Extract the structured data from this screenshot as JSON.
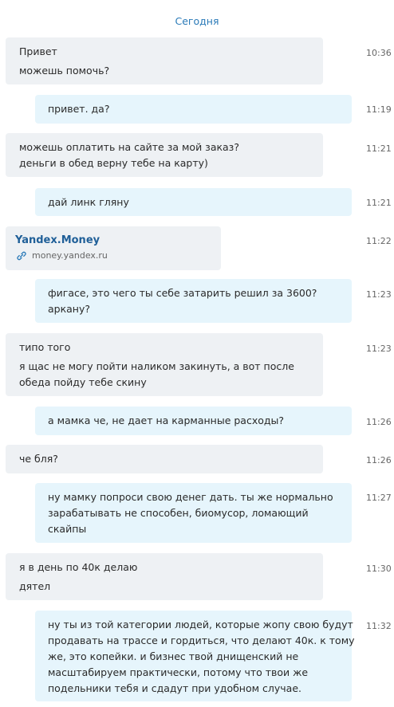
{
  "date_separator": "Сегодня",
  "messages": [
    {
      "dir": "in",
      "lines": [
        "Привет",
        "можешь помочь?"
      ],
      "time": "10:36"
    },
    {
      "dir": "out",
      "lines": [
        "привет. да?"
      ],
      "time": "11:19"
    },
    {
      "dir": "in",
      "lines": [
        "можешь оплатить на сайте за мой заказ?",
        "деньги в обед верну тебе на карту)"
      ],
      "time": "11:21"
    },
    {
      "dir": "out",
      "lines": [
        "дай линк гляну"
      ],
      "time": "11:21"
    },
    {
      "dir": "in",
      "type": "link",
      "title": "Yandex.Money",
      "url": "money.yandex.ru",
      "icon": "link-icon",
      "time": "11:22"
    },
    {
      "dir": "out",
      "lines": [
        "фигасе, это чего ты себе затарить решил за 3600?",
        "аркану?"
      ],
      "time": "11:23"
    },
    {
      "dir": "in",
      "lines": [
        "типо того",
        "я щас не могу пойти наликом закинуть, а вот после",
        "обеда пойду тебе скину"
      ],
      "time": "11:23"
    },
    {
      "dir": "out",
      "lines": [
        "а мамка че, не дает на карманные расходы?"
      ],
      "time": "11:26"
    },
    {
      "dir": "in",
      "lines": [
        "че бля?"
      ],
      "time": "11:26"
    },
    {
      "dir": "out",
      "lines": [
        "ну мамку попроси свою денег дать. ты же нормально",
        "зарабатывать не способен, биомусор, ломающий",
        "скайпы"
      ],
      "time": "11:27"
    },
    {
      "dir": "in",
      "lines": [
        "я в день по 40к делаю",
        "дятел"
      ],
      "time": "11:30"
    },
    {
      "dir": "out",
      "lines": [
        "ну ты из той категории людей, которые жопу свою будут",
        "продавать на трассе и гордиться, что делают 40к. к тому",
        "же, это копейки. и бизнес твой днищенский не",
        "масштабируем практически, потому что твои же",
        "подельники тебя и сдадут при удобном случае."
      ],
      "time": "11:32"
    }
  ],
  "colors": {
    "incoming_bubble": "#eef1f4",
    "outgoing_bubble": "#e6f5fc",
    "date_separator": "#2a7ab8",
    "link_title": "#1f5f98",
    "timestamp": "#666666"
  }
}
